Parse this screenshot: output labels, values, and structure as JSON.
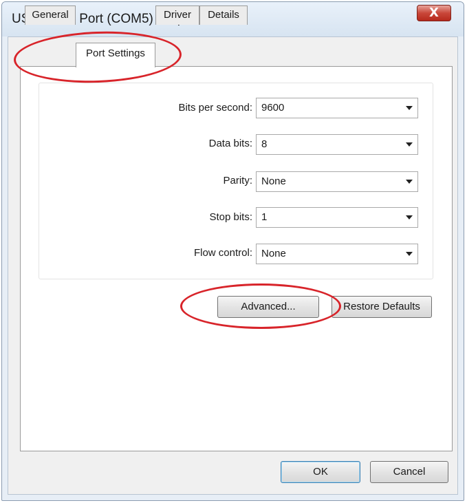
{
  "window": {
    "title": "USB Serial Port (COM5) Properties",
    "close_glyph": "X"
  },
  "tabs": [
    {
      "label": "General"
    },
    {
      "label": "Port Settings"
    },
    {
      "label": "Driver"
    },
    {
      "label": "Details"
    }
  ],
  "active_tab": "Port Settings",
  "settings": {
    "bits_per_second": {
      "label": "Bits per second:",
      "value": "9600"
    },
    "data_bits": {
      "label": "Data bits:",
      "value": "8"
    },
    "parity": {
      "label": "Parity:",
      "value": "None"
    },
    "stop_bits": {
      "label": "Stop bits:",
      "value": "1"
    },
    "flow_control": {
      "label": "Flow control:",
      "value": "None"
    }
  },
  "buttons": {
    "advanced": "Advanced...",
    "restore_defaults": "Restore Defaults",
    "ok": "OK",
    "cancel": "Cancel"
  },
  "colors": {
    "annotation": "#d8242a",
    "close_button": "#c9473a"
  }
}
